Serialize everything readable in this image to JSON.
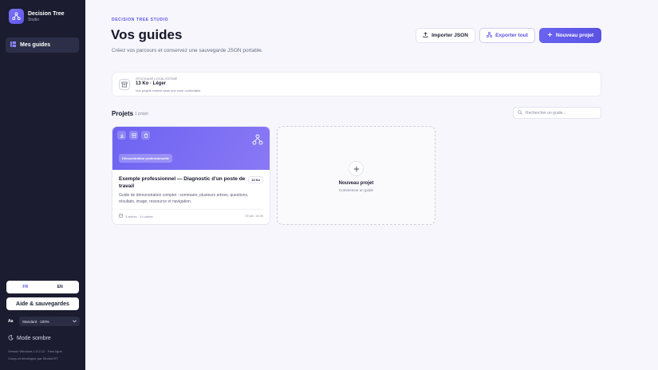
{
  "app": {
    "title": "Decision Tree",
    "subtitle": "Studio"
  },
  "sidebar": {
    "nav_items": [
      {
        "label": "Mes guides",
        "icon": "grid-icon"
      }
    ],
    "languages": [
      "FR",
      "EN"
    ],
    "active_language": "FR",
    "help_label": "Aide & sauvegardes",
    "zoom_label": "Aa",
    "zoom_value": "Standard · 100%",
    "dark_mode_label": "Mode sombre",
    "version": "Version Windows 1.0.2.12 · Hors ligne",
    "credit": "Conçu et développé par StudioVST"
  },
  "header": {
    "eyebrow": "DECISION TREE STUDIO",
    "title": "Vos guides",
    "subtitle": "Créez vos parcours et conservez une sauvegarde JSON portable.",
    "import_label": "Importer JSON",
    "export_label": "Exporter tout",
    "new_label": "Nouveau projet"
  },
  "storage": {
    "label": "STOCKAGE LOCAL ESTIMÉ",
    "value": "13 Ko · Léger",
    "note": "Vos projets restent dans une zone confortable."
  },
  "projects": {
    "heading": "Projets",
    "count": "1 projet",
    "search_placeholder": "Rechercher un guide...",
    "items": [
      {
        "badge": "Démonstration professionnelle",
        "title": "Exemple professionnel — Diagnostic d'un poste de travail",
        "size": "13 Ko",
        "description": "Guide de démonstration complet : sommaire, plusieurs arbres, questions, résultats, image, ressource et navigation.",
        "meta": "3 arbres · 14 cartes",
        "date": "25 juil. 14:05"
      }
    ],
    "new_card_title": "Nouveau projet",
    "new_card_sub": "Commencer un guide"
  },
  "colors": {
    "accent": "#5a52e4",
    "sidebar": "#1b1c30"
  }
}
